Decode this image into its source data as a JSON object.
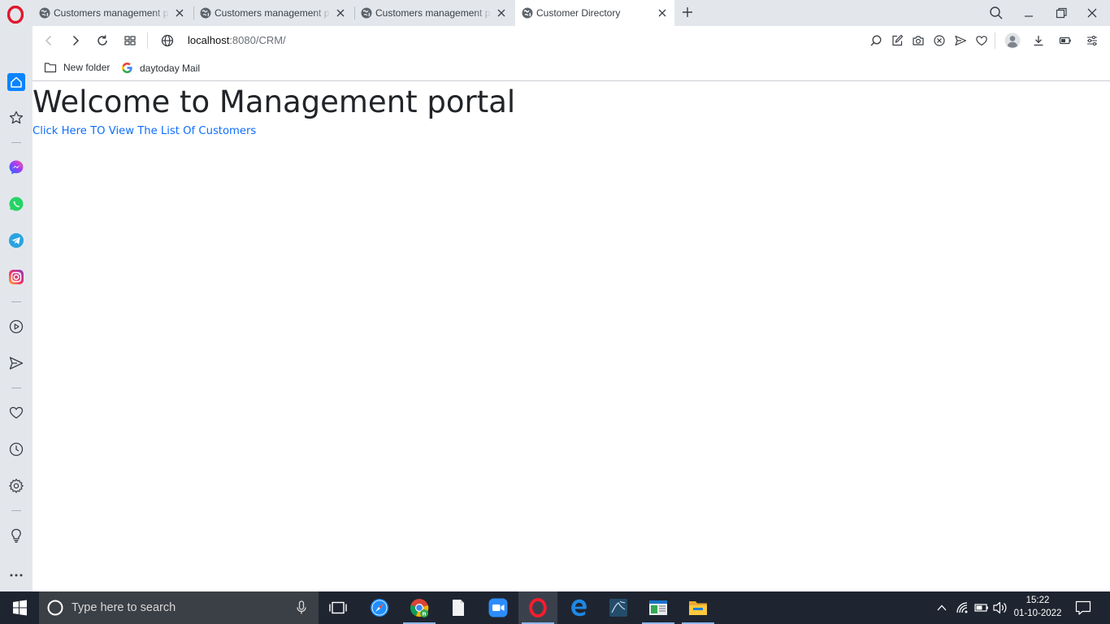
{
  "browser": {
    "tabs": [
      {
        "title": "Customers management p",
        "active": false
      },
      {
        "title": "Customers management p",
        "active": false
      },
      {
        "title": "Customers management p",
        "active": false
      },
      {
        "title": "Customer Directory",
        "active": true
      }
    ],
    "address": {
      "host": "localhost",
      "rest": ":8080/CRM/"
    },
    "bookmarks": [
      {
        "label": "New folder",
        "icon": "folder-icon"
      },
      {
        "label": "daytoday Mail",
        "icon": "google-icon"
      }
    ],
    "accent_color": "#0a84ff"
  },
  "page": {
    "heading": "Welcome to Management portal",
    "link_text": "Click Here TO View The List Of Customers",
    "link_color": "#0d6efd"
  },
  "taskbar": {
    "search_placeholder": "Type here to search",
    "time": "15:22",
    "date": "01-10-2022"
  }
}
